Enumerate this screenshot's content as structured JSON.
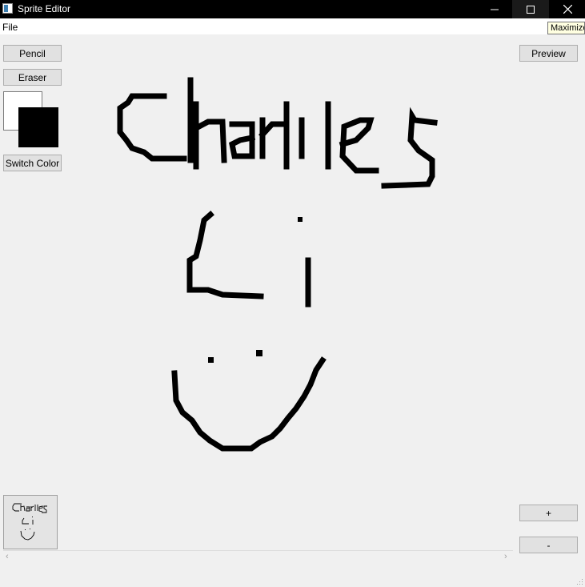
{
  "window": {
    "title": "Sprite Editor",
    "icons": {
      "app": "app-icon",
      "minimize": "minimize-icon",
      "maximize": "maximize-icon",
      "close": "close-icon"
    }
  },
  "menubar": {
    "items": [
      {
        "label": "File"
      }
    ]
  },
  "tooltip": {
    "text": "Maximize"
  },
  "tools": {
    "pencil": "Pencil",
    "eraser": "Eraser",
    "switch_color": "Switch Color"
  },
  "colors": {
    "primary": "#000000",
    "secondary": "#ffffff",
    "background": "#f0f0f0",
    "pixel": "#000000"
  },
  "actions": {
    "preview": "Preview",
    "add_frame": "+",
    "remove_frame": "-"
  },
  "scrollbar": {
    "left_arrow": "‹",
    "right_arrow": "›"
  }
}
